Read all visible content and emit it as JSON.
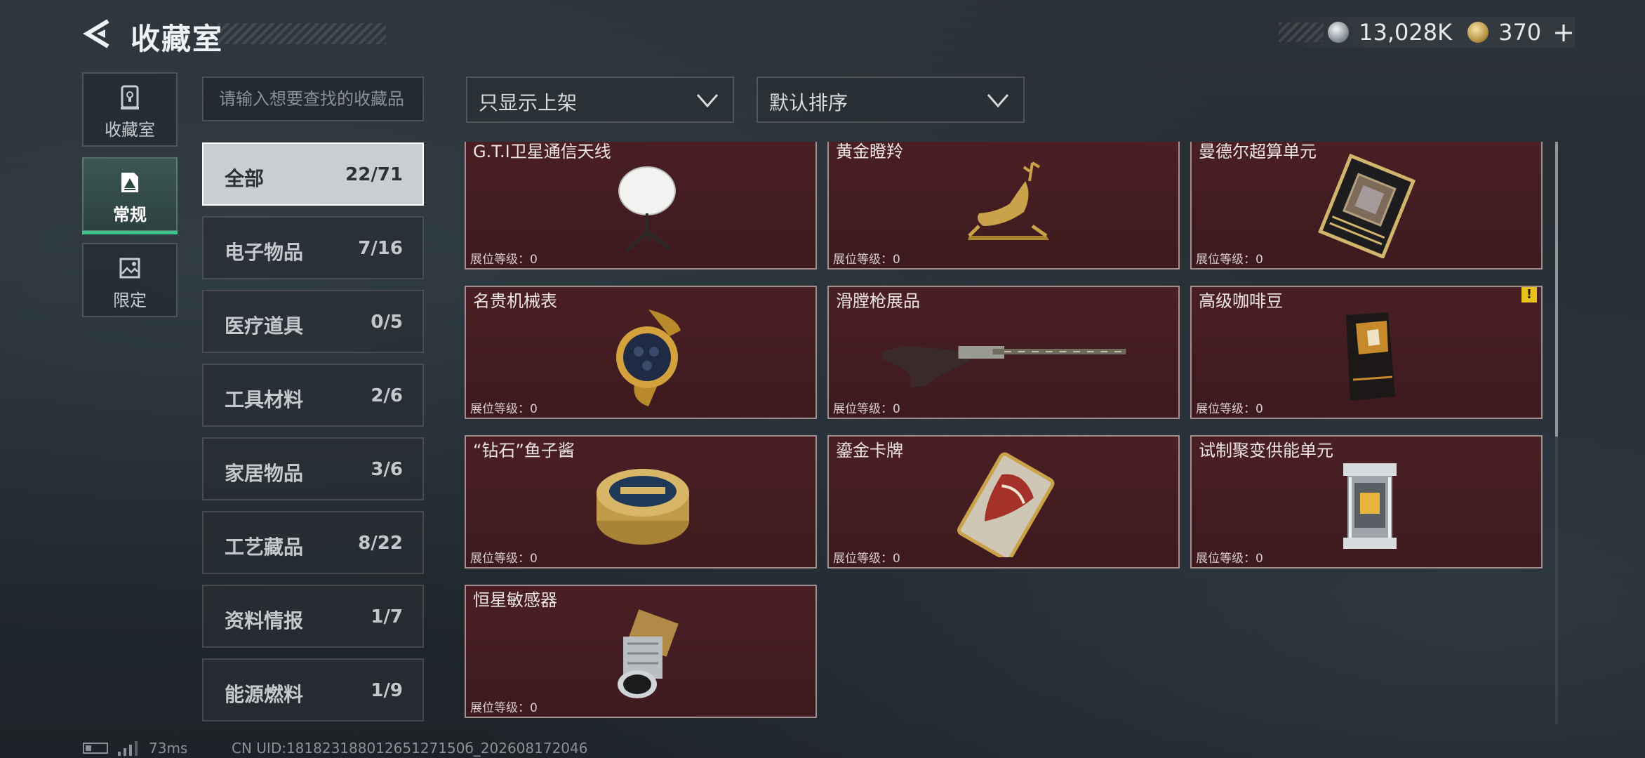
{
  "header": {
    "title": "收藏室",
    "silver_amount": "13,028K",
    "gold_amount": "370",
    "add_symbol": "+"
  },
  "nav": [
    {
      "label": "收藏室",
      "icon": "trophy-room-icon"
    },
    {
      "label": "常规",
      "icon": "picture-frame-icon",
      "active": true
    },
    {
      "label": "限定",
      "icon": "landscape-icon"
    }
  ],
  "search": {
    "placeholder": "请输入想要查找的收藏品"
  },
  "filters": {
    "show_filter": "只显示上架",
    "sort": "默认排序"
  },
  "categories": [
    {
      "label": "全部",
      "count": "22/71",
      "active": true
    },
    {
      "label": "电子物品",
      "count": "7/16"
    },
    {
      "label": "医疗道具",
      "count": "0/5"
    },
    {
      "label": "工具材料",
      "count": "2/6"
    },
    {
      "label": "家居物品",
      "count": "3/6"
    },
    {
      "label": "工艺藏品",
      "count": "8/22"
    },
    {
      "label": "资料情报",
      "count": "1/7"
    },
    {
      "label": "能源燃料",
      "count": "1/9"
    }
  ],
  "items": [
    {
      "name": "G.T.I卫星通信天线",
      "level": "展位等级：0",
      "icon": "satellite-dish-icon"
    },
    {
      "name": "黄金瞪羚",
      "level": "展位等级：0",
      "icon": "golden-gazelle-icon"
    },
    {
      "name": "曼德尔超算单元",
      "level": "展位等级：0",
      "icon": "computing-unit-icon"
    },
    {
      "name": "名贵机械表",
      "level": "展位等级：0",
      "icon": "watch-icon"
    },
    {
      "name": "滑膛枪展品",
      "level": "展位等级：0",
      "icon": "musket-icon"
    },
    {
      "name": "高级咖啡豆",
      "level": "展位等级：0",
      "icon": "coffee-bag-icon",
      "warning": "!"
    },
    {
      "name": "“钻石”鱼子酱",
      "level": "展位等级：0",
      "icon": "caviar-tin-icon"
    },
    {
      "name": "鎏金卡牌",
      "level": "展位等级：0",
      "icon": "gilded-card-icon"
    },
    {
      "name": "试制聚变供能单元",
      "level": "展位等级：0",
      "icon": "fusion-cell-icon"
    },
    {
      "name": "恒星敏感器",
      "level": "展位等级：0",
      "icon": "star-sensor-icon"
    }
  ],
  "colors": {
    "card_bg": "#451d22",
    "active_tab_accent": "#3fc28a",
    "warning": "#e8c21a"
  },
  "status": {
    "ping": "73ms",
    "uid": "CN UID:18182318801265127150б_202608172046"
  }
}
